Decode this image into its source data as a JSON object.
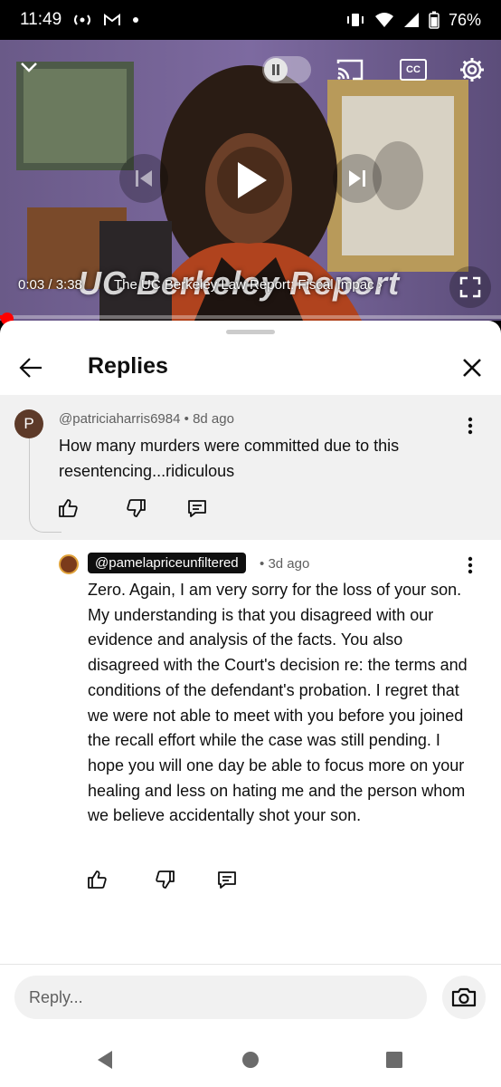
{
  "status_bar": {
    "time": "11:49",
    "battery": "76%",
    "icons": [
      "cast-audio-icon",
      "gmail-icon",
      "dot-icon",
      "vibrate-icon",
      "wifi-icon",
      "signal-icon",
      "battery-icon"
    ]
  },
  "video": {
    "time": "0:03 / 3:38",
    "title": "The UC Berkeley Law Report: Fiscal Impac",
    "overlay_title": "UC Berkeley Report",
    "progress": 0.014,
    "controls": [
      "collapse-icon",
      "autoplay-toggle",
      "cast-icon",
      "captions-icon",
      "settings-icon",
      "previous-icon",
      "play-icon",
      "next-icon",
      "fullscreen-icon"
    ],
    "captions_label": "CC",
    "title_arrow": "›"
  },
  "replies": {
    "title": "Replies",
    "parent": {
      "avatar_letter": "P",
      "author": "@patriciaharris6984",
      "age": "8d ago",
      "text": "How many murders were committed due to this resentencing...ridiculous"
    },
    "reply": {
      "author": "@pamelapriceunfiltered",
      "age": "3d ago",
      "text": "Zero. Again, I am very sorry for the loss of your son. My understanding is that you disagreed with our evidence and analysis of the facts. You also disagreed with the Court's decision re: the terms and conditions of the defendant's probation. I regret that we were not able to meet with you before you joined the recall effort while the case was still pending. I hope you will one day be able to focus more on your healing and less on hating me and the person whom we believe accidentally shot your son."
    },
    "separator": "•"
  },
  "reply_bar": {
    "placeholder": "Reply..."
  },
  "colors": {
    "progress": "#ff0000",
    "sheet_bg": "#ffffff",
    "parent_bg": "#f1f1f1",
    "meta_text": "#606060"
  }
}
